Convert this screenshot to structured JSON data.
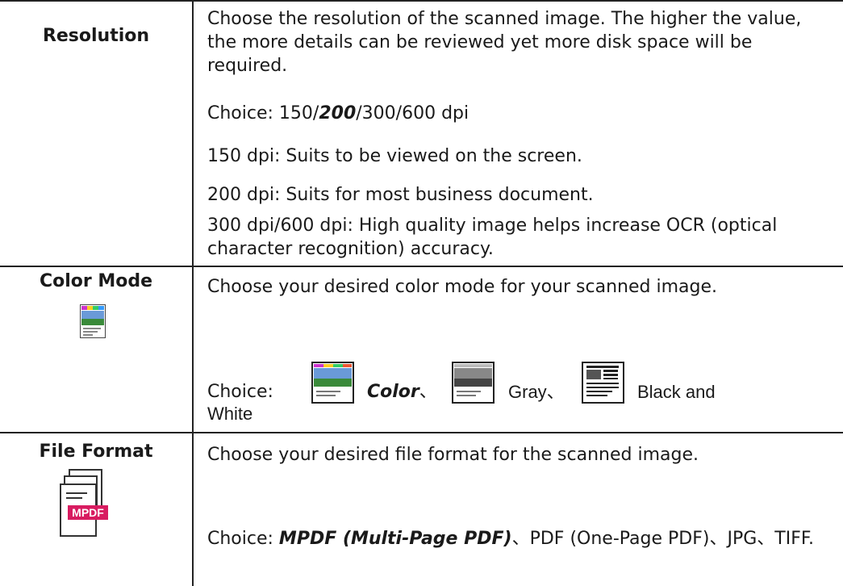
{
  "rows": {
    "resolution": {
      "label": "Resolution",
      "description": "Choose the resolution of the scanned image. The higher the value, the more details can be reviewed yet more disk space will be required.",
      "choice_prefix": "Choice: 150/",
      "choice_default": "200",
      "choice_suffix": "/300/600 dpi",
      "dpi150": "150 dpi: Suits to be viewed on the screen.",
      "dpi200": "200 dpi: Suits for most business document.",
      "dpi300_600": "300 dpi/600 dpi: High quality image helps increase OCR (optical character recognition) accuracy."
    },
    "color_mode": {
      "label": "Color Mode",
      "description": "Choose your desired color mode for your scanned image.",
      "choice_prefix": "Choice:",
      "color": "Color",
      "sep1": "、",
      "gray": "Gray、",
      "bw": "Black and",
      "bw_wrap": "White"
    },
    "file_format": {
      "label": "File Format",
      "icon_text": "MPDF",
      "description": "Choose your desired file format for the scanned image.",
      "choice_prefix": "Choice: ",
      "mpdf": "MPDF (Multi-Page PDF)",
      "rest": "、PDF (One-Page PDF)、JPG、TIFF."
    }
  }
}
